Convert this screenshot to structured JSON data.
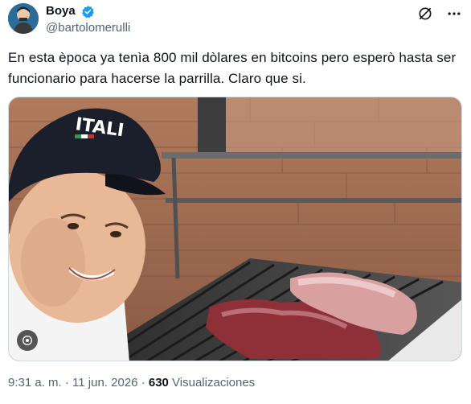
{
  "author": {
    "display_name": "Boya",
    "handle": "@bartolomerulli",
    "verified": true
  },
  "tweet": {
    "text": "En esta època ya tenìa 800 mil dòlares en bitcoins pero esperò hasta ser funcionario para hacerse la parrilla. Claro que si."
  },
  "media": {
    "cap_text": "ITALI",
    "badge_icon": "alt-text-icon"
  },
  "meta": {
    "time": "9:31 a. m.",
    "separator1": " · ",
    "date": "11 jun. 2026",
    "separator2": " · ",
    "views_count": "630",
    "views_label": " Visualizaciones"
  },
  "colors": {
    "verified": "#1d9bf0",
    "secondary_text": "#536471",
    "primary_text": "#0f1419"
  }
}
